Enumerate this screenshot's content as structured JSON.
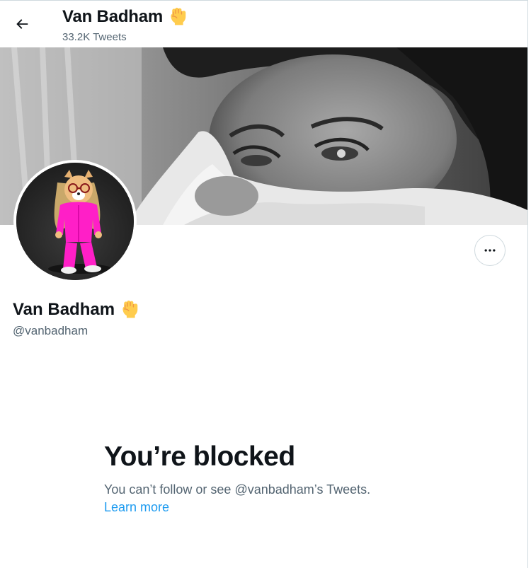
{
  "header": {
    "back_icon": "arrow-left-icon",
    "name": "Van Badham",
    "name_emoji": "raised-fist-emoji",
    "tweet_count": "33.2K Tweets"
  },
  "banner": {
    "description": "grayscale-portrait-photo"
  },
  "avatar": {
    "description": "dog-in-pink-tracksuit-image"
  },
  "more_button": {
    "icon": "more-horizontal-icon"
  },
  "profile": {
    "name": "Van Badham",
    "name_emoji": "raised-fist-emoji",
    "handle": "@vanbadham"
  },
  "blocked": {
    "title": "You’re blocked",
    "message": "You can’t follow or see @vanbadham’s Tweets.",
    "link_label": "Learn more"
  },
  "colors": {
    "text_primary": "#0f1419",
    "text_secondary": "#536471",
    "link": "#1d9bf0",
    "border": "#cfd9de",
    "emoji_yellow": "#ffcc4d"
  }
}
